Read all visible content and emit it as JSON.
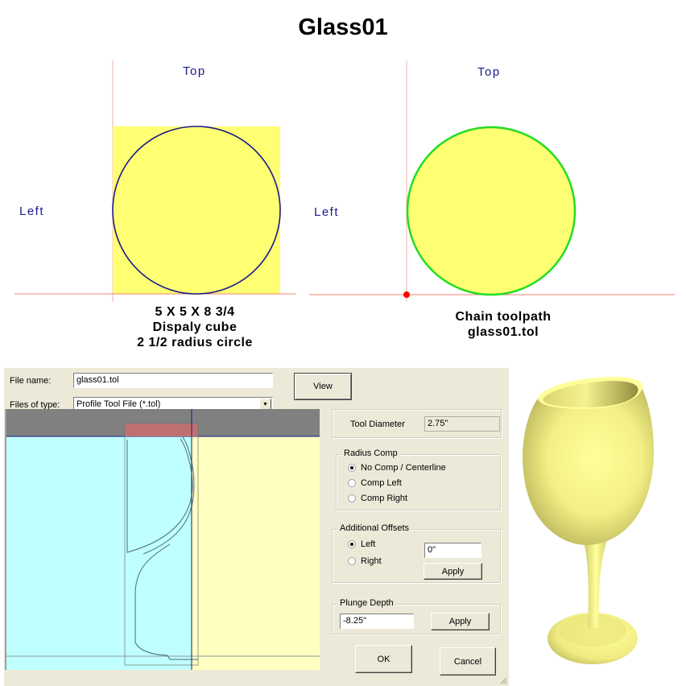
{
  "title": "Glass01",
  "top_views": [
    {
      "name": "display-cube-view",
      "top_label": "Top",
      "left_label": "Left",
      "caption_lines": [
        "5 X 5 X 8 3/4",
        "Dispaly cube",
        "2 1/2 radius circle"
      ],
      "circle_color": "#1a1a8c",
      "fill_color": "#ffff73"
    },
    {
      "name": "chain-toolpath-view",
      "top_label": "Top",
      "left_label": "Left",
      "caption_lines": [
        "Chain toolpath",
        "glass01.tol"
      ],
      "circle_color": "#22dd22",
      "fill_color": "#ffff73",
      "origin_marker_color": "#ff0000"
    }
  ],
  "dialog": {
    "file_name_label": "File name:",
    "file_name_value": "glass01.tol",
    "files_of_type_label": "Files of type:",
    "files_of_type_value": "Profile Tool File (*.tol)",
    "view_button": "View",
    "tool_diameter_label": "Tool Diameter",
    "tool_diameter_value": "2.75\"",
    "radius_comp": {
      "legend": "Radius Comp",
      "options": [
        {
          "label": "No Comp / Centerline",
          "checked": true
        },
        {
          "label": "Comp Left",
          "checked": false
        },
        {
          "label": "Comp Right",
          "checked": false
        }
      ]
    },
    "additional_offsets": {
      "legend": "Additional Offsets",
      "options": [
        {
          "label": "Left",
          "checked": true
        },
        {
          "label": "Right",
          "checked": false
        }
      ],
      "value": "0\"",
      "apply_button": "Apply"
    },
    "plunge_depth": {
      "legend": "Plunge Depth",
      "value": "-8.25\"",
      "apply_button": "Apply"
    },
    "ok_button": "OK",
    "cancel_button": "Cancel",
    "preview_colors": {
      "header": "#808080",
      "left_region": "#c0ffff",
      "right_region": "#ffffc0",
      "stock_top": "#c07070",
      "axis": "#1a1a8c"
    }
  },
  "render": {
    "name": "glass-3d-render",
    "color": "#ffff99"
  }
}
